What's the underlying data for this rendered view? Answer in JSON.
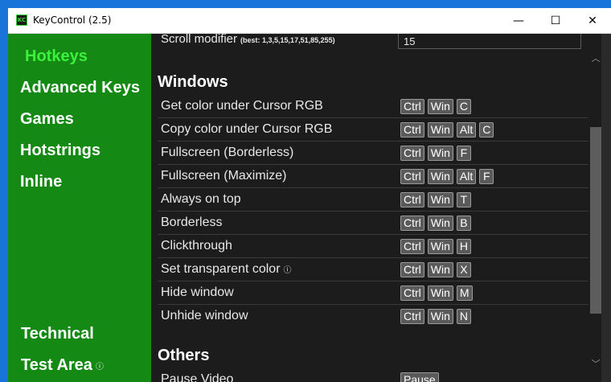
{
  "window": {
    "title": "KeyControl (2.5)",
    "app_icon_text": "KC",
    "minimize_glyph": "—",
    "maximize_glyph": "☐",
    "close_glyph": "✕"
  },
  "sidebar": {
    "items": [
      {
        "label": "Hotkeys",
        "active": true
      },
      {
        "label": "Advanced Keys"
      },
      {
        "label": "Games"
      },
      {
        "label": "Hotstrings"
      },
      {
        "label": "Inline"
      }
    ],
    "bottom_items": [
      {
        "label": "Technical"
      },
      {
        "label": "Test Area",
        "info": "ⓘ"
      }
    ]
  },
  "scroll_modifier": {
    "label": "Scroll modifier",
    "hint": "(best: 1,3,5,15,17,51,85,255)",
    "value": "15"
  },
  "sections": {
    "windows": {
      "title": "Windows",
      "rows": [
        {
          "label": "Get color under Cursor RGB",
          "keys": [
            "Ctrl",
            "Win",
            "C"
          ]
        },
        {
          "label": "Copy color under Cursor RGB",
          "keys": [
            "Ctrl",
            "Win",
            "Alt",
            "C"
          ]
        },
        {
          "label": "Fullscreen (Borderless)",
          "keys": [
            "Ctrl",
            "Win",
            "F"
          ]
        },
        {
          "label": "Fullscreen (Maximize)",
          "keys": [
            "Ctrl",
            "Win",
            "Alt",
            "F"
          ]
        },
        {
          "label": "Always on top",
          "keys": [
            "Ctrl",
            "Win",
            "T"
          ]
        },
        {
          "label": "Borderless",
          "keys": [
            "Ctrl",
            "Win",
            "B"
          ]
        },
        {
          "label": "Clickthrough",
          "keys": [
            "Ctrl",
            "Win",
            "H"
          ]
        },
        {
          "label": "Set transparent color",
          "info": "ⓘ",
          "keys": [
            "Ctrl",
            "Win",
            "X"
          ]
        },
        {
          "label": "Hide window",
          "keys": [
            "Ctrl",
            "Win",
            "M"
          ]
        },
        {
          "label": "Unhide window",
          "keys": [
            "Ctrl",
            "Win",
            "N"
          ]
        }
      ]
    },
    "others": {
      "title": "Others",
      "rows": [
        {
          "label": "Pause Video",
          "keys": [
            "Pause"
          ]
        }
      ]
    }
  },
  "scrollbar": {
    "up_glyph": "︿",
    "down_glyph": "﹀"
  },
  "colors": {
    "sidebar_bg": "#148a14",
    "active_nav": "#3cf03c",
    "content_bg": "#1c1c1c",
    "key_bg": "#5a5a5a",
    "desktop": "#1874d8"
  }
}
